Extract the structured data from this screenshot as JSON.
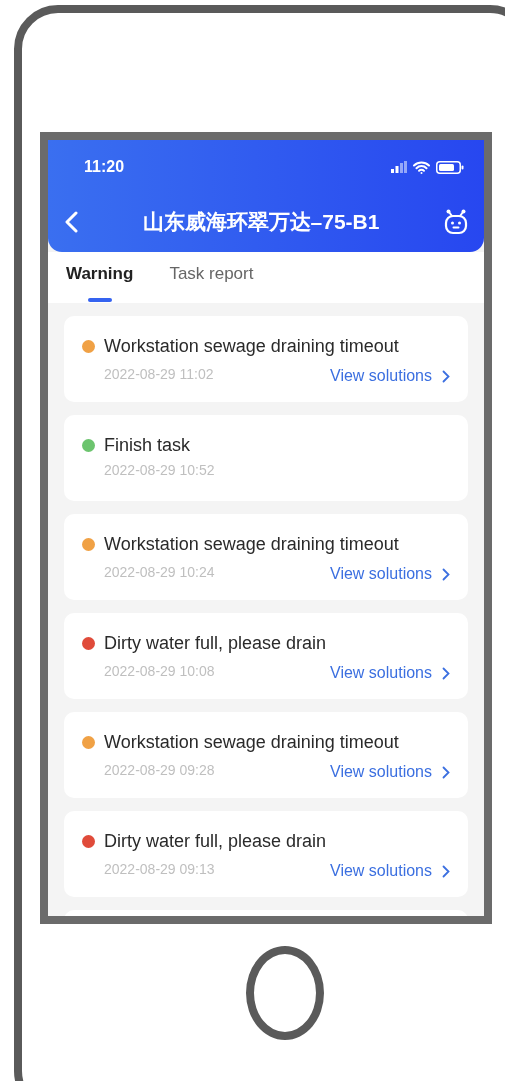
{
  "status_bar": {
    "time": "11:20"
  },
  "header": {
    "title": "山东威海环翠万达–75-B1"
  },
  "tabs": [
    {
      "label": "Warning",
      "selected": true
    },
    {
      "label": "Task report",
      "selected": false
    }
  ],
  "warnings": [
    {
      "color": "#f0a145",
      "title": "Workstation sewage draining timeout",
      "time": "2022-08-29 11:02",
      "link": "View solutions"
    },
    {
      "color": "#6cc46e",
      "title": "Finish task",
      "time": "2022-08-29 10:52"
    },
    {
      "color": "#f0a145",
      "title": "Workstation sewage draining timeout",
      "time": "2022-08-29 10:24",
      "link": "View solutions"
    },
    {
      "color": "#e04b3a",
      "title": "Dirty water full, please drain",
      "time": "2022-08-29 10:08",
      "link": "View solutions"
    },
    {
      "color": "#f0a145",
      "title": "Workstation sewage draining timeout",
      "time": "2022-08-29 09:28",
      "link": "View solutions"
    },
    {
      "color": "#e04b3a",
      "title": "Dirty water full, please drain",
      "time": "2022-08-29 09:13",
      "link": "View solutions"
    }
  ]
}
